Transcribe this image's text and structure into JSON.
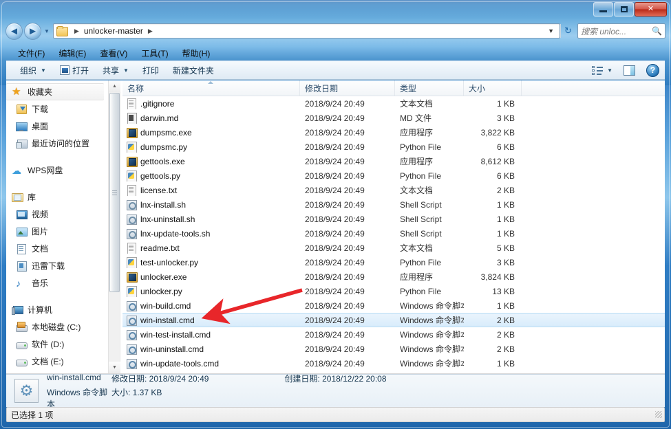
{
  "titlebar": {
    "minimize_label": "最小化",
    "maximize_label": "最大化",
    "close_label": "✕"
  },
  "navigation": {
    "back_label": "◄",
    "forward_label": "►",
    "recent_dropdown": "▼",
    "address_folder": "folder-icon",
    "address_path": "unlocker-master",
    "address_chevron_lead": "▶",
    "address_chevron_trail": "▶",
    "address_dropdown": "▼",
    "refresh_label": "↻"
  },
  "search": {
    "placeholder": "搜索 unloc...",
    "icon": "search-icon"
  },
  "menu": {
    "items": [
      {
        "label": "文件(F)"
      },
      {
        "label": "编辑(E)"
      },
      {
        "label": "查看(V)"
      },
      {
        "label": "工具(T)"
      },
      {
        "label": "帮助(H)"
      }
    ]
  },
  "toolbar": {
    "organize": "组织",
    "organize_caret": "▼",
    "open": "打开",
    "share": "共享",
    "share_caret": "▼",
    "print": "打印",
    "new_folder": "新建文件夹",
    "view_caret": "▼",
    "help_glyph": "?"
  },
  "sidebar": {
    "groups": [
      {
        "header": {
          "label": "收藏夹",
          "icon": "star-icon",
          "selected": true
        },
        "items": [
          {
            "label": "下载",
            "icon": "download-icon"
          },
          {
            "label": "桌面",
            "icon": "desktop-icon"
          },
          {
            "label": "最近访问的位置",
            "icon": "recent-places-icon"
          }
        ]
      },
      {
        "header": {
          "label": "WPS网盘",
          "icon": "cloud-icon",
          "selected": false
        },
        "items": []
      },
      {
        "header": {
          "label": "库",
          "icon": "library-icon",
          "selected": false
        },
        "items": [
          {
            "label": "视频",
            "icon": "video-icon"
          },
          {
            "label": "图片",
            "icon": "picture-icon"
          },
          {
            "label": "文档",
            "icon": "document-icon"
          },
          {
            "label": "迅雷下载",
            "icon": "xunlei-icon"
          },
          {
            "label": "音乐",
            "icon": "music-icon"
          }
        ]
      },
      {
        "header": {
          "label": "计算机",
          "icon": "computer-icon",
          "selected": false
        },
        "items": [
          {
            "label": "本地磁盘 (C:)",
            "icon": "system-drive-icon"
          },
          {
            "label": "软件 (D:)",
            "icon": "drive-icon"
          },
          {
            "label": "文档 (E:)",
            "icon": "drive-icon"
          }
        ]
      }
    ],
    "scroll_up": "▲",
    "scroll_down": "▼"
  },
  "filelist": {
    "columns": [
      "名称",
      "修改日期",
      "类型",
      "大小"
    ],
    "sort_column": "名称",
    "sort_direction": "ascending",
    "rows": [
      {
        "name": ".gitignore",
        "date": "2018/9/24 20:49",
        "type": "文本文档",
        "size": "1 KB",
        "icon": "text-file-icon",
        "selected": false
      },
      {
        "name": "darwin.md",
        "date": "2018/9/24 20:49",
        "type": "MD 文件",
        "size": "3 KB",
        "icon": "md-file-icon",
        "selected": false
      },
      {
        "name": "dumpsmc.exe",
        "date": "2018/9/24 20:49",
        "type": "应用程序",
        "size": "3,822 KB",
        "icon": "exe-file-icon",
        "selected": false
      },
      {
        "name": "dumpsmc.py",
        "date": "2018/9/24 20:49",
        "type": "Python File",
        "size": "6 KB",
        "icon": "python-file-icon",
        "selected": false
      },
      {
        "name": "gettools.exe",
        "date": "2018/9/24 20:49",
        "type": "应用程序",
        "size": "8,612 KB",
        "icon": "exe-file-icon",
        "selected": false
      },
      {
        "name": "gettools.py",
        "date": "2018/9/24 20:49",
        "type": "Python File",
        "size": "6 KB",
        "icon": "python-file-icon",
        "selected": false
      },
      {
        "name": "license.txt",
        "date": "2018/9/24 20:49",
        "type": "文本文档",
        "size": "2 KB",
        "icon": "text-file-icon",
        "selected": false
      },
      {
        "name": "lnx-install.sh",
        "date": "2018/9/24 20:49",
        "type": "Shell Script",
        "size": "1 KB",
        "icon": "shell-file-icon",
        "selected": false
      },
      {
        "name": "lnx-uninstall.sh",
        "date": "2018/9/24 20:49",
        "type": "Shell Script",
        "size": "1 KB",
        "icon": "shell-file-icon",
        "selected": false
      },
      {
        "name": "lnx-update-tools.sh",
        "date": "2018/9/24 20:49",
        "type": "Shell Script",
        "size": "1 KB",
        "icon": "shell-file-icon",
        "selected": false
      },
      {
        "name": "readme.txt",
        "date": "2018/9/24 20:49",
        "type": "文本文档",
        "size": "5 KB",
        "icon": "text-file-icon",
        "selected": false
      },
      {
        "name": "test-unlocker.py",
        "date": "2018/9/24 20:49",
        "type": "Python File",
        "size": "3 KB",
        "icon": "python-file-icon",
        "selected": false
      },
      {
        "name": "unlocker.exe",
        "date": "2018/9/24 20:49",
        "type": "应用程序",
        "size": "3,824 KB",
        "icon": "exe-file-icon",
        "selected": false
      },
      {
        "name": "unlocker.py",
        "date": "2018/9/24 20:49",
        "type": "Python File",
        "size": "13 KB",
        "icon": "python-file-icon",
        "selected": false
      },
      {
        "name": "win-build.cmd",
        "date": "2018/9/24 20:49",
        "type": "Windows 命令脚本",
        "size": "1 KB",
        "icon": "cmd-file-icon",
        "selected": false
      },
      {
        "name": "win-install.cmd",
        "date": "2018/9/24 20:49",
        "type": "Windows 命令脚本",
        "size": "2 KB",
        "icon": "cmd-file-icon",
        "selected": true
      },
      {
        "name": "win-test-install.cmd",
        "date": "2018/9/24 20:49",
        "type": "Windows 命令脚本",
        "size": "2 KB",
        "icon": "cmd-file-icon",
        "selected": false
      },
      {
        "name": "win-uninstall.cmd",
        "date": "2018/9/24 20:49",
        "type": "Windows 命令脚本",
        "size": "2 KB",
        "icon": "cmd-file-icon",
        "selected": false
      },
      {
        "name": "win-update-tools.cmd",
        "date": "2018/9/24 20:49",
        "type": "Windows 命令脚本",
        "size": "1 KB",
        "icon": "cmd-file-icon",
        "selected": false
      }
    ]
  },
  "annotation": {
    "type": "red-arrow",
    "color": "#e8262a",
    "target": "win-install.cmd"
  },
  "details": {
    "filename": "win-install.cmd",
    "modified_label": "修改日期: 2018/9/24 20:49",
    "created_label": "创建日期: 2018/12/22 20:08",
    "filetype": "Windows 命令脚本",
    "size_label": "大小: 1.37 KB"
  },
  "statusbar": {
    "text": "已选择 1 项"
  }
}
